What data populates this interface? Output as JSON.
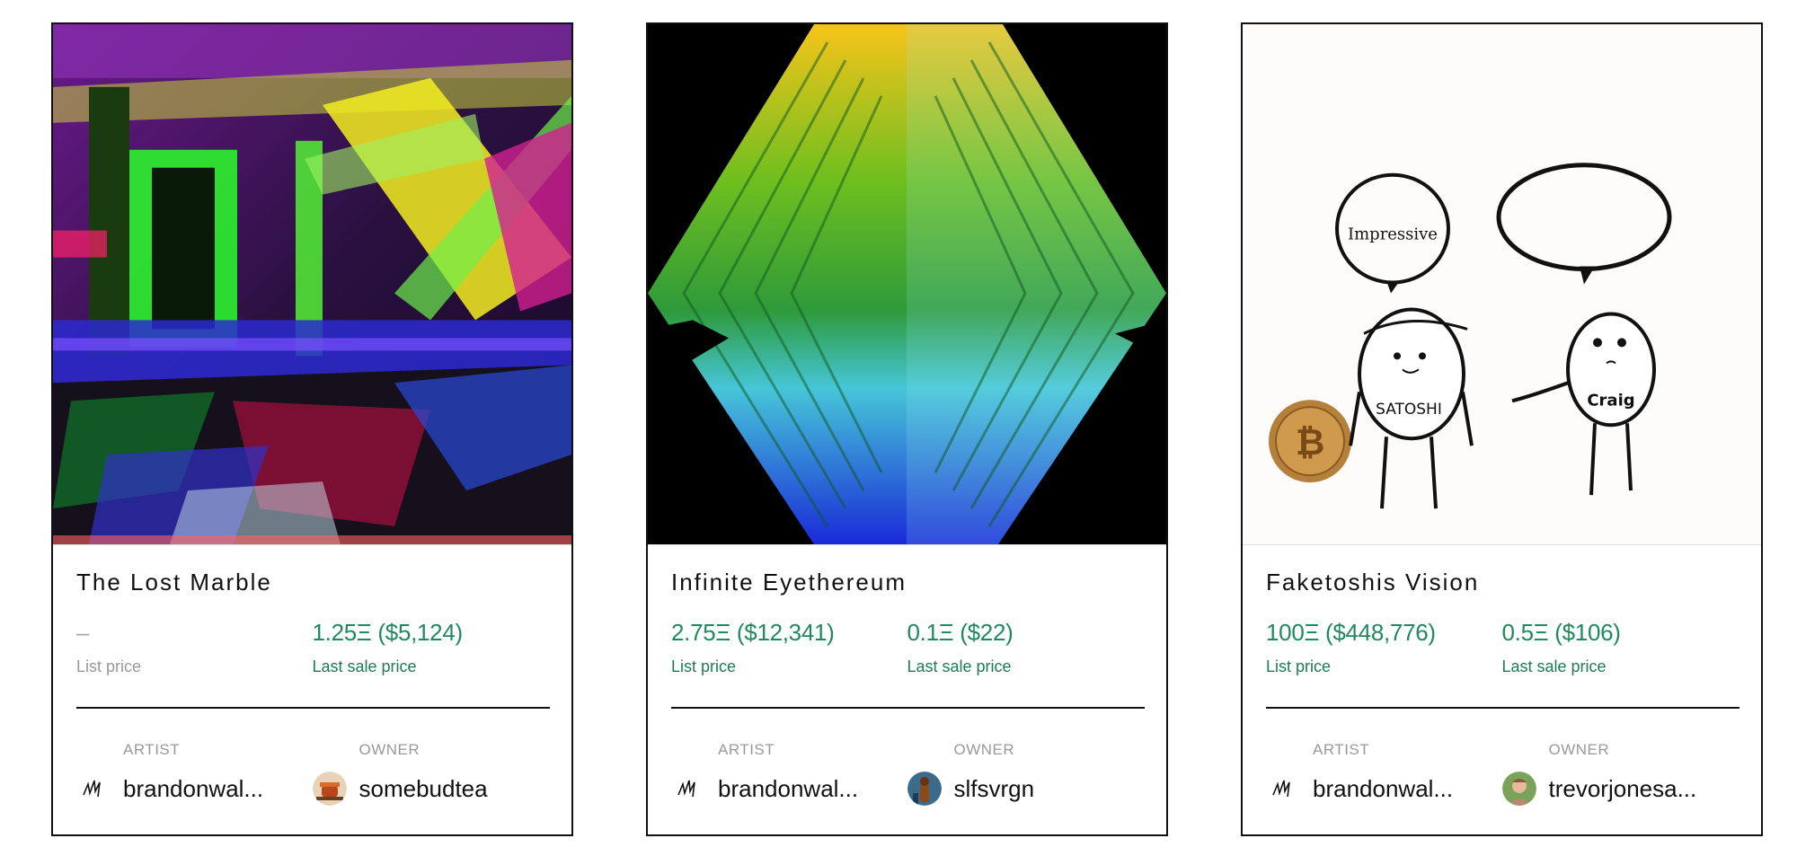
{
  "cards": [
    {
      "title": "The Lost Marble",
      "list_price": "–",
      "list_price_label": "List price",
      "last_sale_price": "1.25Ξ ($5,124)",
      "last_sale_label": "Last sale price",
      "artist_role": "ARTIST",
      "artist_name": "brandonwal...",
      "owner_role": "OWNER",
      "owner_name": "somebudtea",
      "owner_avatar_icon": "tea-cup-avatar-icon"
    },
    {
      "title": "Infinite Eyethereum",
      "list_price": "2.75Ξ ($12,341)",
      "list_price_label": "List price",
      "last_sale_price": "0.1Ξ ($22)",
      "last_sale_label": "Last sale price",
      "artist_role": "ARTIST",
      "artist_name": "brandonwal...",
      "owner_role": "OWNER",
      "owner_name": "slfsvrgn",
      "owner_avatar_icon": "figure-avatar-icon"
    },
    {
      "title": "Faketoshis Vision",
      "list_price": "100Ξ ($448,776)",
      "list_price_label": "List price",
      "last_sale_price": "0.5Ξ ($106)",
      "last_sale_label": "Last sale price",
      "artist_role": "ARTIST",
      "artist_name": "brandonwal...",
      "owner_role": "OWNER",
      "owner_name": "trevorjonesa...",
      "owner_avatar_icon": "portrait-avatar-icon",
      "art_text": {
        "bubble": "Impressive",
        "left_figure": "SATOSHI",
        "right_figure": "Craig"
      }
    }
  ],
  "colors": {
    "price_green": "#1f8a5e",
    "muted": "#999999",
    "border": "#111111"
  }
}
